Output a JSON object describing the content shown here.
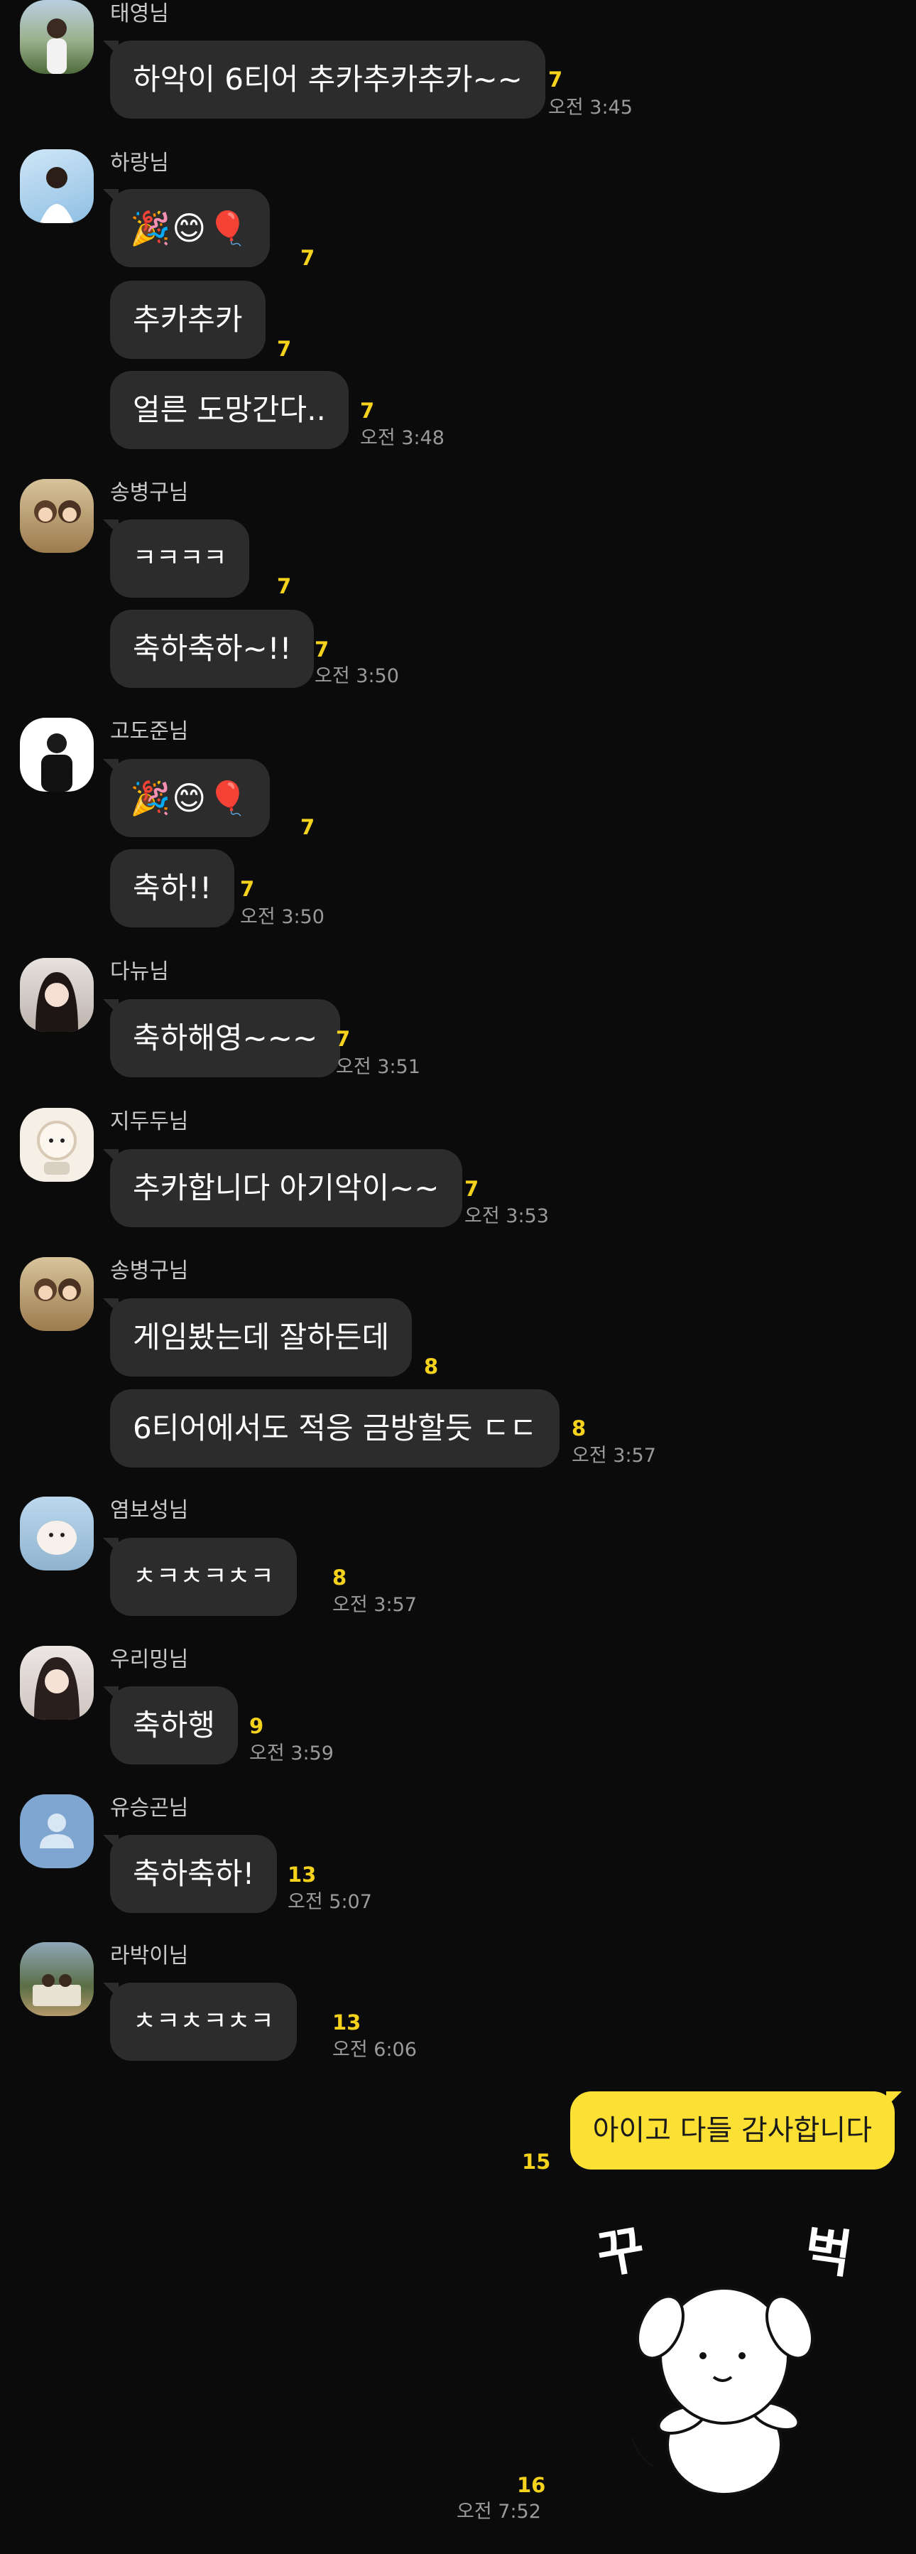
{
  "messages": [
    {
      "sender": "태영님",
      "bubbles": [
        {
          "text": "하악이 6티어 추카추카추카~~",
          "count": "7",
          "time": "오전 3:45"
        }
      ]
    },
    {
      "sender": "하랑님",
      "bubbles": [
        {
          "text": "🎉😊🎈",
          "count": "7"
        },
        {
          "text": "추카추카",
          "count": "7"
        },
        {
          "text": "얼른 도망간다..",
          "count": "7",
          "time": "오전 3:48"
        }
      ]
    },
    {
      "sender": "송병구님",
      "bubbles": [
        {
          "text": "ㅋㅋㅋㅋ",
          "count": "7"
        },
        {
          "text": "축하축하~!!",
          "count": "7",
          "time": "오전 3:50"
        }
      ]
    },
    {
      "sender": "고도준님",
      "bubbles": [
        {
          "text": "🎉😊🎈",
          "count": "7"
        },
        {
          "text": "축하!!",
          "count": "7",
          "time": "오전 3:50"
        }
      ]
    },
    {
      "sender": "다뉴님",
      "bubbles": [
        {
          "text": "축하해영~~~",
          "count": "7",
          "time": "오전 3:51"
        }
      ]
    },
    {
      "sender": "지두두님",
      "bubbles": [
        {
          "text": "추카합니다 아기악이~~",
          "count": "7",
          "time": "오전 3:53"
        }
      ]
    },
    {
      "sender": "송병구님",
      "bubbles": [
        {
          "text": "게임봤는데 잘하든데",
          "count": "8"
        },
        {
          "text": "6티어에서도 적응 금방할듯 ㄷㄷ",
          "count": "8",
          "time": "오전 3:57"
        }
      ]
    },
    {
      "sender": "염보성님",
      "bubbles": [
        {
          "text": "ㅊㅋㅊㅋㅊㅋ",
          "count": "8",
          "time": "오전 3:57"
        }
      ]
    },
    {
      "sender": "우리밍님",
      "bubbles": [
        {
          "text": "축하행",
          "count": "9",
          "time": "오전 3:59"
        }
      ]
    },
    {
      "sender": "유승곤님",
      "bubbles": [
        {
          "text": "축하축하!",
          "count": "13",
          "time": "오전 5:07"
        }
      ]
    },
    {
      "sender": "라박이님",
      "bubbles": [
        {
          "text": "ㅊㅋㅊㅋㅊㅋ",
          "count": "13",
          "time": "오전 6:06"
        }
      ]
    }
  ],
  "my_messages": [
    {
      "text": "아이고 다들 감사합니다",
      "count": "15"
    },
    {
      "sticker_caption_left": "꾸",
      "sticker_caption_right": "벅",
      "count": "16",
      "time": "오전 7:52"
    }
  ],
  "colors": {
    "background": "#0b0b0b",
    "bubble": "#2c2c2c",
    "my_bubble": "#fde034",
    "unread": "#f5d21c",
    "time": "#9a9a9a"
  }
}
